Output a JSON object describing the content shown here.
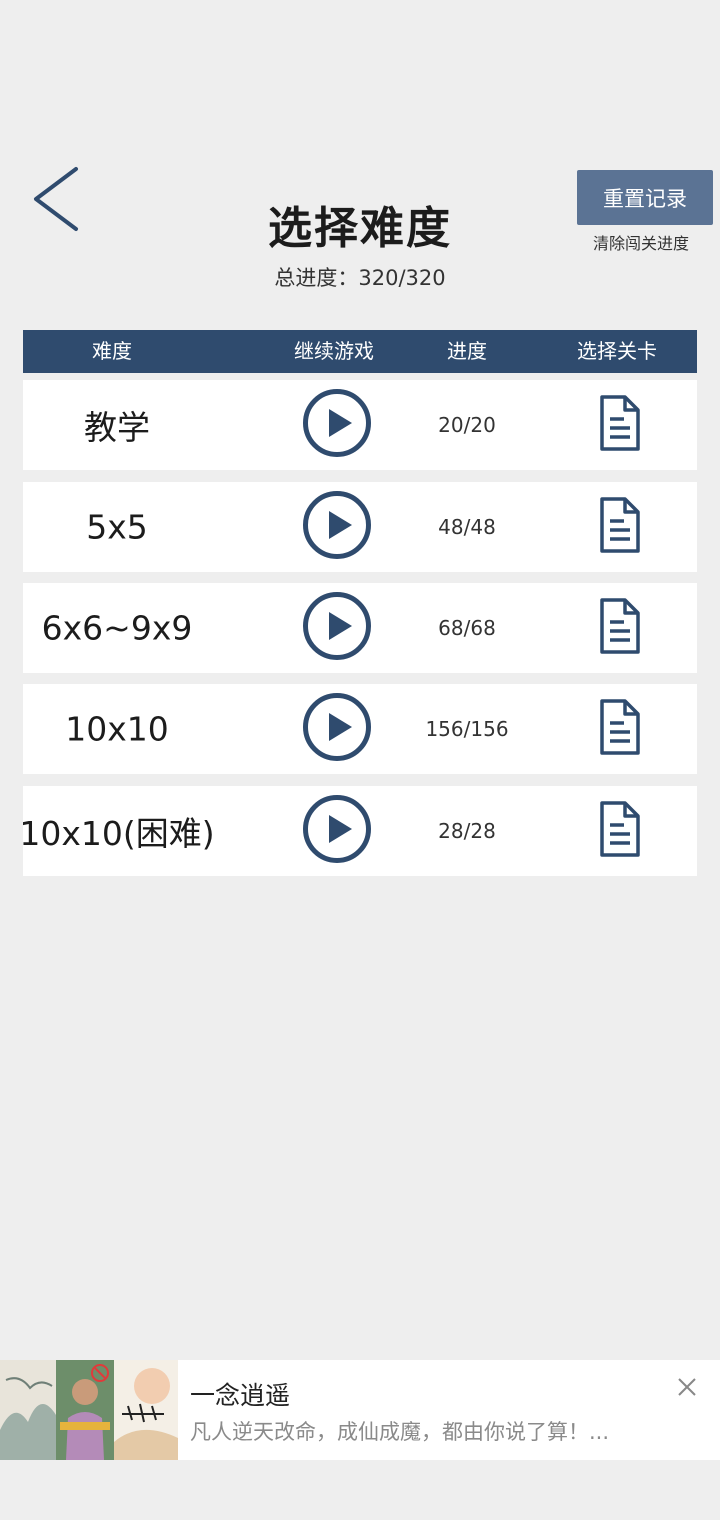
{
  "header": {
    "title": "选择难度",
    "total_progress": "总进度：320/320",
    "reset_button": "重置记录",
    "reset_hint": "清除闯关进度"
  },
  "table": {
    "headers": [
      "难度",
      "继续游戏",
      "进度",
      "选择关卡"
    ],
    "rows": [
      {
        "name": "教学",
        "progress": "20/20"
      },
      {
        "name": "5x5",
        "progress": "48/48"
      },
      {
        "name": "6x6~9x9",
        "progress": "68/68"
      },
      {
        "name": "10x10",
        "progress": "156/156"
      },
      {
        "name": "10x10(困难)",
        "progress": "28/28"
      }
    ]
  },
  "icons": {
    "back": "chevron-left-icon",
    "play": "play-circle-icon",
    "level_select": "document-icon",
    "close": "close-icon"
  },
  "ad": {
    "title": "一念逍遥",
    "description": "凡人逆天改命，成仙成魔，都由你说了算！..."
  },
  "colors": {
    "accent": "#2f4b6e",
    "button": "#5b7394",
    "background": "#eeeeee"
  }
}
